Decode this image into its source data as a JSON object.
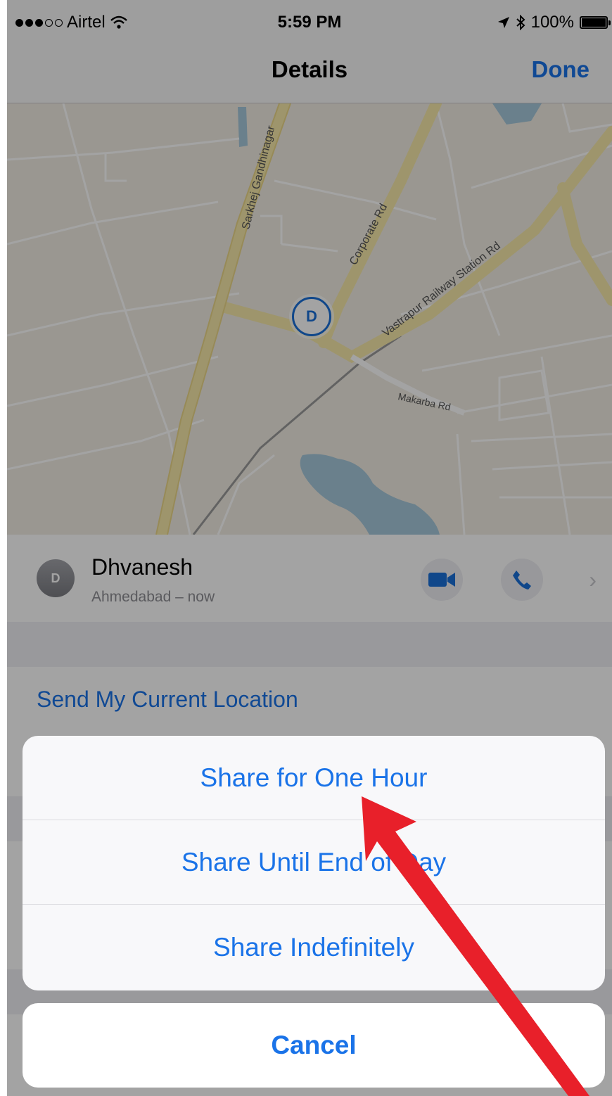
{
  "status_bar": {
    "carrier": "Airtel",
    "time": "5:59 PM",
    "battery": "100%",
    "signal_filled": 3,
    "signal_total": 5
  },
  "nav": {
    "title": "Details",
    "done_label": "Done"
  },
  "map": {
    "roads": {
      "sarkhej": "Sarkhej Gandhinagar",
      "corporate": "Corporate Rd",
      "vastrapur": "Vastrapur Railway Station Rd",
      "makarba": "Makarba Rd"
    },
    "pin_initial": "D"
  },
  "contact": {
    "initial": "D",
    "name": "Dhvanesh",
    "subtitle": "Ahmedabad – now"
  },
  "send_location_label": "Send My Current Location",
  "action_sheet": {
    "options": [
      "Share for One Hour",
      "Share Until End of Day",
      "Share Indefinitely"
    ],
    "cancel_label": "Cancel"
  },
  "colors": {
    "accent": "#1a73e8",
    "arrow": "#e8202a",
    "water": "#a6c8dc"
  }
}
